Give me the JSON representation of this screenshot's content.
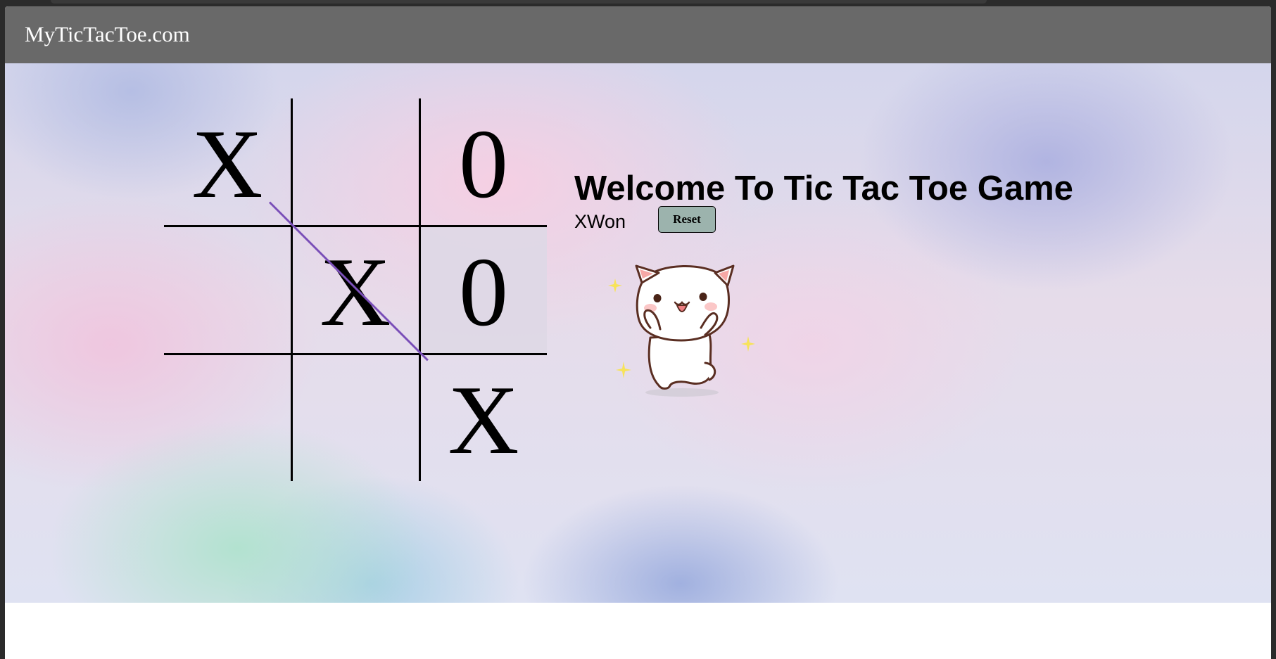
{
  "app": {
    "brand": "MyTicTacToe.com"
  },
  "game": {
    "title": "Welcome To Tic Tac Toe Game",
    "status": "XWon",
    "reset_label": "Reset",
    "board": [
      "X",
      "",
      "0",
      "",
      "X",
      "0",
      "",
      "",
      "X"
    ],
    "highlighted_cell": 5,
    "winning_line": [
      0,
      4,
      8
    ],
    "strike_color": "#7a4fb8",
    "celebration_image": "happy-cat-sticker"
  }
}
